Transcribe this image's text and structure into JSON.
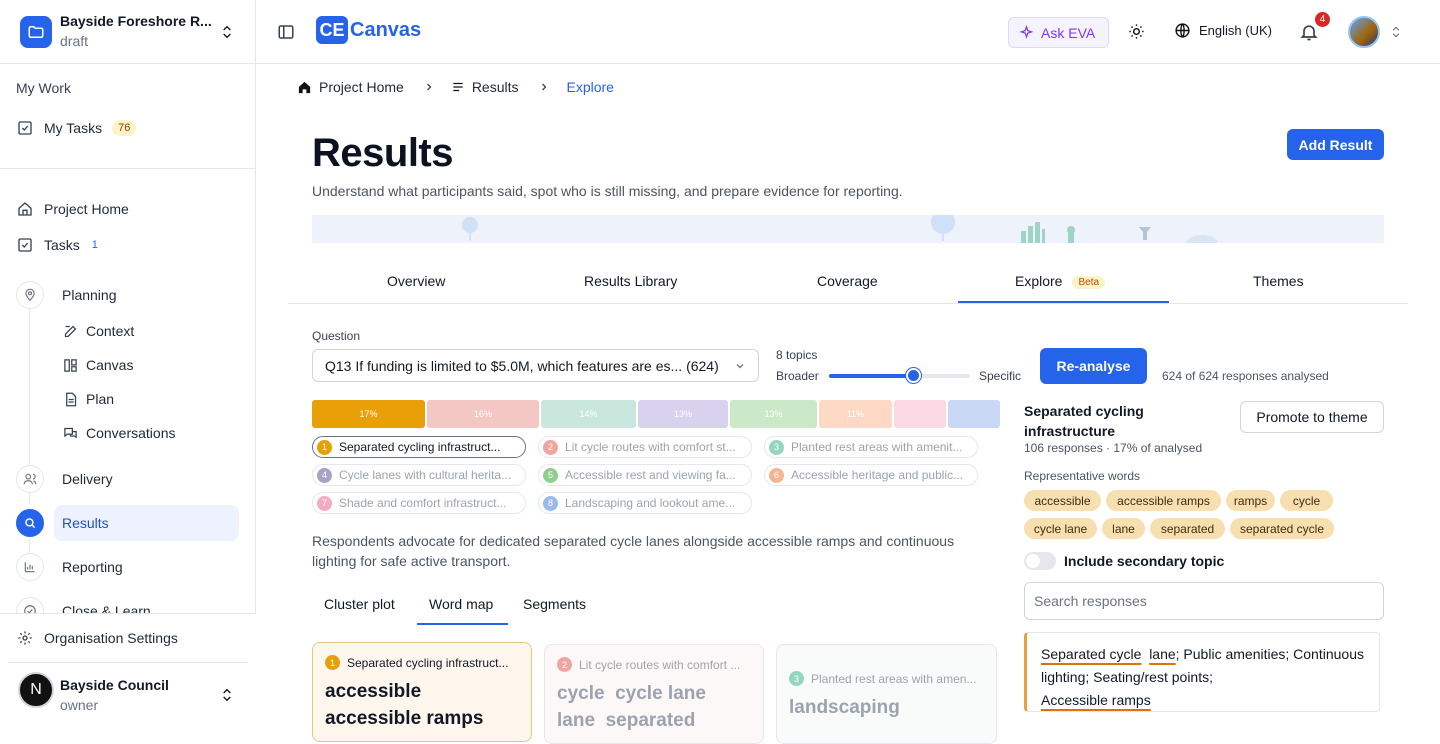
{
  "project": {
    "name": "Bayside Foreshore R...",
    "status": "draft"
  },
  "sidebar": {
    "my_work": "My Work",
    "my_tasks": {
      "label": "My Tasks",
      "count": "76"
    },
    "project_home": "Project Home",
    "tasks": {
      "label": "Tasks",
      "count": "1"
    },
    "planning": "Planning",
    "planning_items": [
      "Context",
      "Canvas",
      "Plan",
      "Conversations"
    ],
    "delivery": "Delivery",
    "results": "Results",
    "reporting": "Reporting",
    "close_learn": "Close & Learn",
    "org_settings": "Organisation Settings",
    "org": {
      "initial": "N",
      "name": "Bayside Council",
      "role": "owner"
    }
  },
  "header": {
    "logo_mark": "CE",
    "logo_text": "Canvas",
    "ask": "Ask EVA",
    "language": "English (UK)",
    "notifications": "4"
  },
  "breadcrumb": [
    "Project Home",
    "Results",
    "Explore"
  ],
  "page": {
    "title": "Results",
    "subtitle": "Understand what participants said, spot who is still missing, and prepare evidence for reporting.",
    "add_button": "Add Result"
  },
  "tabs": [
    "Overview",
    "Results Library",
    "Coverage",
    "Explore",
    "Themes"
  ],
  "beta": "Beta",
  "explore": {
    "question_label": "Question",
    "question_value": "Q13 If funding is limited to $5.0M, which features are es... (624)",
    "topics": "8 topics",
    "broader": "Broader",
    "specific": "Specific",
    "slider_level": 0.6,
    "reanalyse": "Re-analyse",
    "analysed": "624 of 624 responses analysed",
    "segments": [
      {
        "label": "17%",
        "color": "#e9a008"
      },
      {
        "label": "16%",
        "color": "#f2c7c4"
      },
      {
        "label": "14%",
        "color": "#c9e7dc"
      },
      {
        "label": "13%",
        "color": "#d9d2ef"
      },
      {
        "label": "13%",
        "color": "#cbe8c8"
      },
      {
        "label": "11%",
        "color": "#fcd9c4"
      },
      {
        "label": "",
        "color": "#fbd9e4"
      },
      {
        "label": "",
        "color": "#c8d8f5"
      }
    ],
    "topic_list": [
      {
        "n": "1",
        "label": "Separated cycling infrastruct...",
        "color": "#e9a008"
      },
      {
        "n": "2",
        "label": "Lit cycle routes with comfort st...",
        "color": "#f2a5a0"
      },
      {
        "n": "3",
        "label": "Planted rest areas with amenit...",
        "color": "#93d5bf"
      },
      {
        "n": "4",
        "label": "Cycle lanes with cultural herita...",
        "color": "#a9a2c7"
      },
      {
        "n": "5",
        "label": "Accessible rest and viewing fa...",
        "color": "#8fcf8a"
      },
      {
        "n": "6",
        "label": "Accessible heritage and public...",
        "color": "#f5b58f"
      },
      {
        "n": "7",
        "label": "Shade and comfort infrastruct...",
        "color": "#f5a9c3"
      },
      {
        "n": "8",
        "label": "Landscaping and lookout ame...",
        "color": "#9bb8ef"
      }
    ],
    "summary": "Respondents advocate for dedicated separated cycle lanes alongside accessible ramps and continuous lighting for safe active transport.",
    "subtabs": [
      "Cluster plot",
      "Word map",
      "Segments"
    ],
    "cards": [
      {
        "n": "1",
        "title": "Separated cycling infrastruct...",
        "words": [
          "accessible",
          "accessible ramps"
        ]
      },
      {
        "n": "2",
        "title": "Lit cycle routes with comfort ...",
        "words": [
          "cycle  cycle lane",
          "lane  separated"
        ]
      },
      {
        "n": "3",
        "title": "Planted rest areas with amen...",
        "words": [
          "landscaping"
        ]
      }
    ]
  },
  "panel": {
    "title": "Separated cycling infrastructure",
    "meta": "106 responses · 17% of analysed",
    "promote": "Promote to theme",
    "rep_label": "Representative words",
    "words": [
      "accessible",
      "accessible ramps",
      "ramps",
      "cycle",
      "cycle lane",
      "lane",
      "separated",
      "separated cycle"
    ],
    "toggle": "Include secondary topic",
    "search_placeholder": "Search responses",
    "response": {
      "h1": "Separated cycle",
      "h2": "lane",
      "t1": "; Public amenities; Continuous lighting; Seating/rest points;",
      "h3": "Accessible ramps"
    }
  }
}
